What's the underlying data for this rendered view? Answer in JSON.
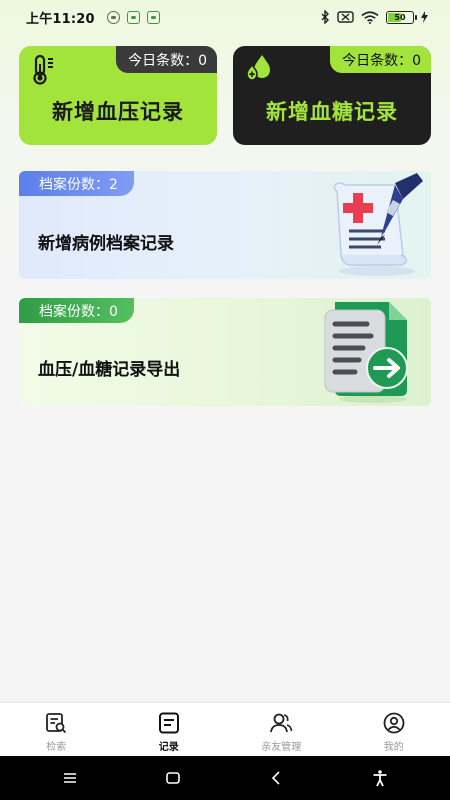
{
  "status": {
    "time": "上午11:20",
    "battery": "50"
  },
  "cards": {
    "bp": {
      "count": "今日条数：0",
      "label": "新增血压记录",
      "icon": "thermometer-icon"
    },
    "bs": {
      "count": "今日条数：0",
      "label": "新增血糖记录",
      "icon": "blood-drop-icon"
    }
  },
  "wide_cards": {
    "case": {
      "tag": "档案份数：2",
      "label": "新增病例档案记录",
      "icon": "medical-scroll-icon"
    },
    "export": {
      "tag": "档案份数：0",
      "label": "血压/血糖记录导出",
      "icon": "document-export-icon"
    }
  },
  "nav": {
    "items": [
      {
        "label": "检索",
        "icon": "search-document-icon"
      },
      {
        "label": "记录",
        "icon": "record-icon"
      },
      {
        "label": "亲友管理",
        "icon": "people-icon"
      },
      {
        "label": "我的",
        "icon": "profile-icon"
      }
    ]
  },
  "colors": {
    "accent_green": "#a3e43c",
    "dark_card": "#1f1f1f",
    "case_tag_blue": "#5c7fe9",
    "export_tag_green": "#2f9d46"
  }
}
